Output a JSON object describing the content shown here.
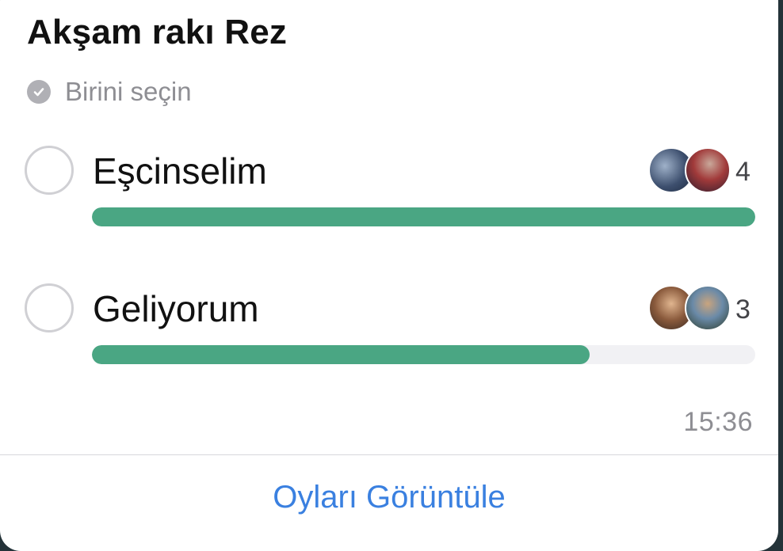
{
  "poll": {
    "title": "Akşam rakı Rez",
    "subtitle": "Birini seçin",
    "options": [
      {
        "label": "Eşcinselim",
        "count": "4",
        "progress": 1.0,
        "avatar_icons": [
          "user-avatar-photo",
          "user-avatar-photo"
        ]
      },
      {
        "label": "Geliyorum",
        "count": "3",
        "progress": 0.75,
        "avatar_icons": [
          "user-avatar-photo",
          "user-avatar-photo"
        ]
      }
    ],
    "time": "15:36",
    "view_votes_label": "Oyları Görüntüle"
  },
  "colors": {
    "accent_green": "#4aa683",
    "link_blue": "#3a80e0",
    "track_gray": "#f1f1f4"
  }
}
